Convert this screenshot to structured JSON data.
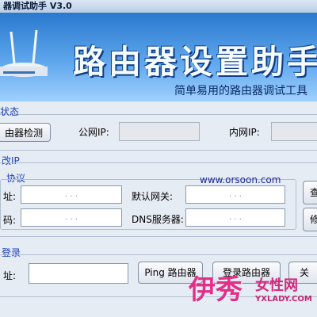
{
  "window": {
    "title": "器调试助手 V3.0"
  },
  "banner": {
    "title": "路由器设置助手",
    "subtitle": "简单易用的路由器调试工具"
  },
  "status_section": {
    "label": "状态",
    "detect_button": "由器检测",
    "wan_ip_label": "公网IP:",
    "lan_ip_label": "内网IP:"
  },
  "modify_ip": {
    "label": "改IP",
    "protocol_label": "协议",
    "addr_label": "址:",
    "mask_label": "码:",
    "gateway_label": "默认网关:",
    "dns_label": "DNS服务器:",
    "ip_placeholder": ".  .  .",
    "url": "www.orsoon.com",
    "btn1": "查",
    "btn2": "修"
  },
  "login_section": {
    "label": "登录",
    "addr_label": "址:",
    "ping_button": "Ping 路由器",
    "login_button": "登录路由器",
    "close_button": "关"
  },
  "watermark": {
    "brand": "伊秀",
    "site": "女性网",
    "url": "YXLADY.COM"
  },
  "colors": {
    "section_label": "#1b3fbf",
    "banner_top": "#2a79cf",
    "banner_bottom": "#9fd0ff",
    "watermark": "#e0308a"
  }
}
